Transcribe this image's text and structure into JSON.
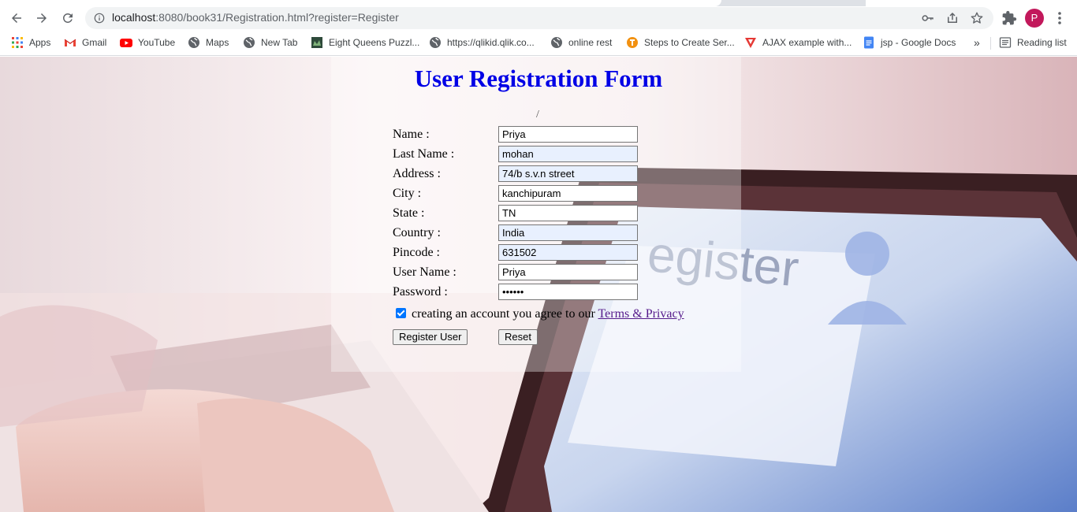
{
  "browser": {
    "url_host": "localhost",
    "url_rest": ":8080/book31/Registration.html?register=Register",
    "avatar_initial": "P",
    "bookmarks": [
      {
        "label": "Apps",
        "icon": "apps-grid-icon"
      },
      {
        "label": "Gmail",
        "icon": "gmail-icon"
      },
      {
        "label": "YouTube",
        "icon": "youtube-icon"
      },
      {
        "label": "Maps",
        "icon": "globe-icon"
      },
      {
        "label": "New Tab",
        "icon": "globe-icon"
      },
      {
        "label": "Eight Queens Puzzl...",
        "icon": "site-favicon-icon"
      },
      {
        "label": "https://qlikid.qlik.co...",
        "icon": "globe-icon"
      },
      {
        "label": "online rest",
        "icon": "globe-icon"
      },
      {
        "label": "Steps to Create Ser...",
        "icon": "site-favicon-icon"
      },
      {
        "label": "AJAX example with...",
        "icon": "site-favicon-icon"
      },
      {
        "label": "jsp - Google Docs",
        "icon": "google-docs-icon"
      }
    ],
    "overflow_label": "»",
    "reading_list_label": "Reading list"
  },
  "form": {
    "title": "User Registration Form",
    "slash": "/",
    "fields": [
      {
        "label": "Name :",
        "value": "Priya"
      },
      {
        "label": "Last Name :",
        "value": "mohan"
      },
      {
        "label": "Address :",
        "value": "74/b s.v.n street"
      },
      {
        "label": "City :",
        "value": "kanchipuram"
      },
      {
        "label": "State :",
        "value": "TN"
      },
      {
        "label": "Country :",
        "value": "India"
      },
      {
        "label": "Pincode :",
        "value": "631502"
      },
      {
        "label": "User Name :",
        "value": "Priya"
      },
      {
        "label": "Password :",
        "value": "••••••"
      }
    ],
    "agree_text": "creating an account you agree to our",
    "terms_link": "Terms & Privacy",
    "agree_checked": true,
    "register_button": "Register User",
    "reset_button": "Reset"
  },
  "colors": {
    "title": "#0000e6",
    "link": "#551a8b",
    "autofill": "#e8f0fe",
    "checkbox": "#0075ff"
  }
}
